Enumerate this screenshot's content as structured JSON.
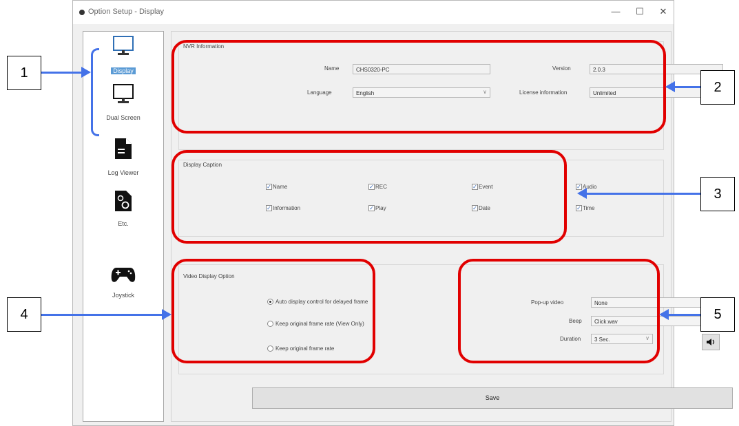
{
  "window": {
    "title": "Option Setup - Display",
    "minimize": "—",
    "maximize": "☐",
    "close": "✕"
  },
  "sidebar": {
    "items": [
      {
        "label": "Display",
        "icon": "monitor-icon",
        "selected": true
      },
      {
        "label": "Dual Screen",
        "icon": "monitor-icon"
      },
      {
        "label": "Log Viewer",
        "icon": "document-icon"
      },
      {
        "label": "Etc.",
        "icon": "gear-document-icon"
      },
      {
        "label": "Joystick",
        "icon": "joystick-icon"
      }
    ]
  },
  "nvr_info": {
    "title": "NVR Information",
    "name_label": "Name",
    "name_value": "CHS0320-PC",
    "language_label": "Language",
    "language_value": "English",
    "version_label": "Version",
    "version_value": "2.0.3",
    "license_label": "License information",
    "license_value": "Unlimited"
  },
  "display_caption": {
    "title": "Display Caption",
    "checkboxes": [
      {
        "label": "Name",
        "checked": true
      },
      {
        "label": "REC",
        "checked": true
      },
      {
        "label": "Event",
        "checked": true
      },
      {
        "label": "Audio",
        "checked": true
      },
      {
        "label": "Information",
        "checked": true
      },
      {
        "label": "Play",
        "checked": true
      },
      {
        "label": "Date",
        "checked": true
      },
      {
        "label": "Time",
        "checked": true
      }
    ]
  },
  "video_display": {
    "title": "Video Display Option",
    "options": [
      {
        "label": "Auto display control for delayed frame",
        "selected": true
      },
      {
        "label": "Keep original frame rate (View Only)",
        "selected": false
      },
      {
        "label": "Keep original frame rate",
        "selected": false
      }
    ]
  },
  "popup": {
    "popup_label": "Pop-up video",
    "popup_value": "None",
    "beep_label": "Beep",
    "beep_value": "Click.wav",
    "duration_label": "Duration",
    "duration_value": "3 Sec.",
    "speaker_icon": "speaker-icon"
  },
  "save_label": "Save",
  "callouts": [
    "1",
    "2",
    "3",
    "4",
    "5"
  ],
  "colors": {
    "highlight": "#e10000",
    "arrow": "#4472e8",
    "selected": "#5b9bd5"
  }
}
